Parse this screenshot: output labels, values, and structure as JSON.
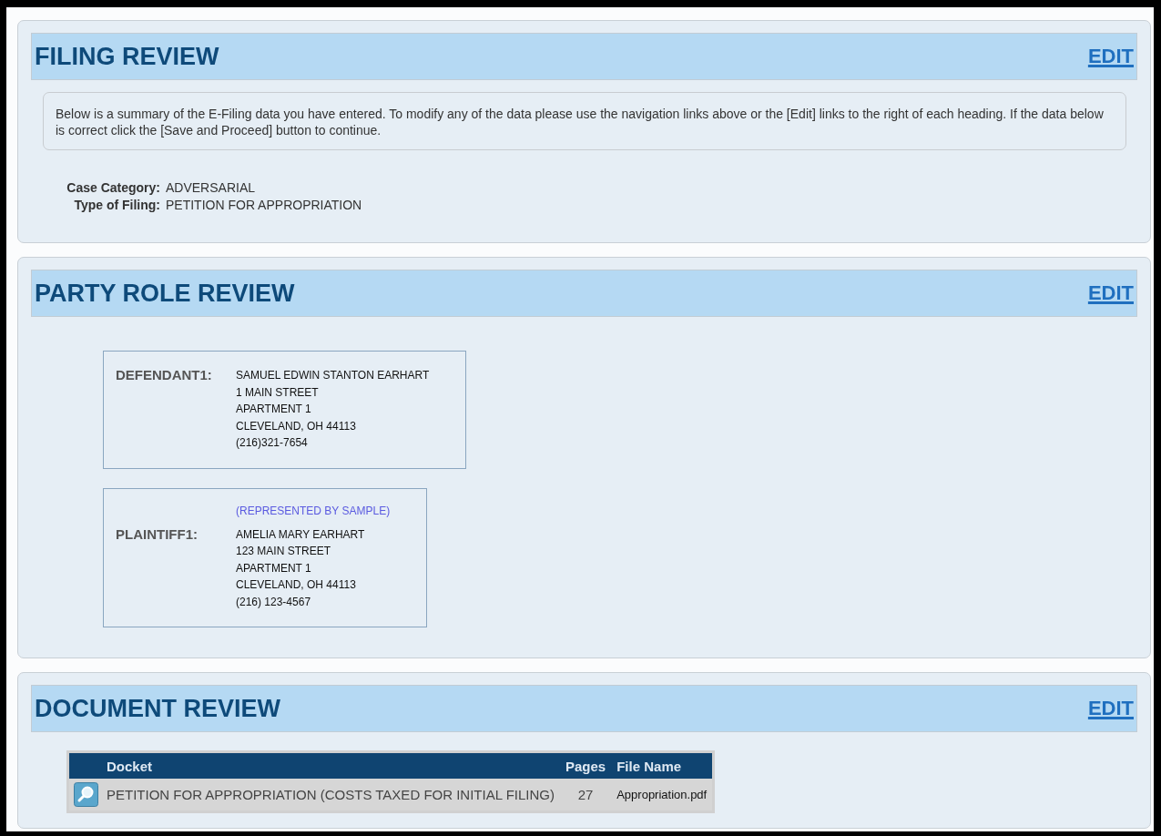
{
  "sections": [
    {
      "kind": "filing",
      "title": "FILING REVIEW",
      "edit": "EDIT",
      "notice": "Below is a summary of the E-Filing data you have entered. To modify any of the data please use the navigation links above or the [Edit] links to the right of each heading. If the data below is correct click the [Save and Proceed] button to continue.",
      "fields": [
        {
          "label": "Case Category:",
          "value": "ADVERSARIAL"
        },
        {
          "label": "Type of Filing:",
          "value": "PETITION FOR APPROPRIATION"
        }
      ]
    },
    {
      "kind": "parties",
      "title": "PARTY ROLE REVIEW",
      "edit": "EDIT",
      "parties": [
        {
          "role": "DEFENDANT1:",
          "lines": [
            "SAMUEL EDWIN STANTON EARHART",
            "1 MAIN STREET",
            "APARTMENT 1",
            "CLEVELAND, OH 44113",
            "(216)321-7654"
          ]
        },
        {
          "role": "PLAINTIFF1:",
          "representation": "(REPRESENTED BY SAMPLE)",
          "lines": [
            "AMELIA MARY EARHART",
            "123 MAIN STREET",
            "APARTMENT 1",
            "CLEVELAND, OH 44113",
            "(216) 123-4567"
          ]
        }
      ]
    },
    {
      "kind": "documents",
      "title": "DOCUMENT REVIEW",
      "edit": "EDIT",
      "table": {
        "columns": [
          "Docket",
          "Pages",
          "File Name"
        ],
        "rows": [
          {
            "docket": "PETITION FOR APPROPRIATION (COSTS TAXED FOR INITIAL FILING)",
            "pages": "27",
            "file_name": "Appropriation.pdf"
          }
        ]
      }
    }
  ]
}
